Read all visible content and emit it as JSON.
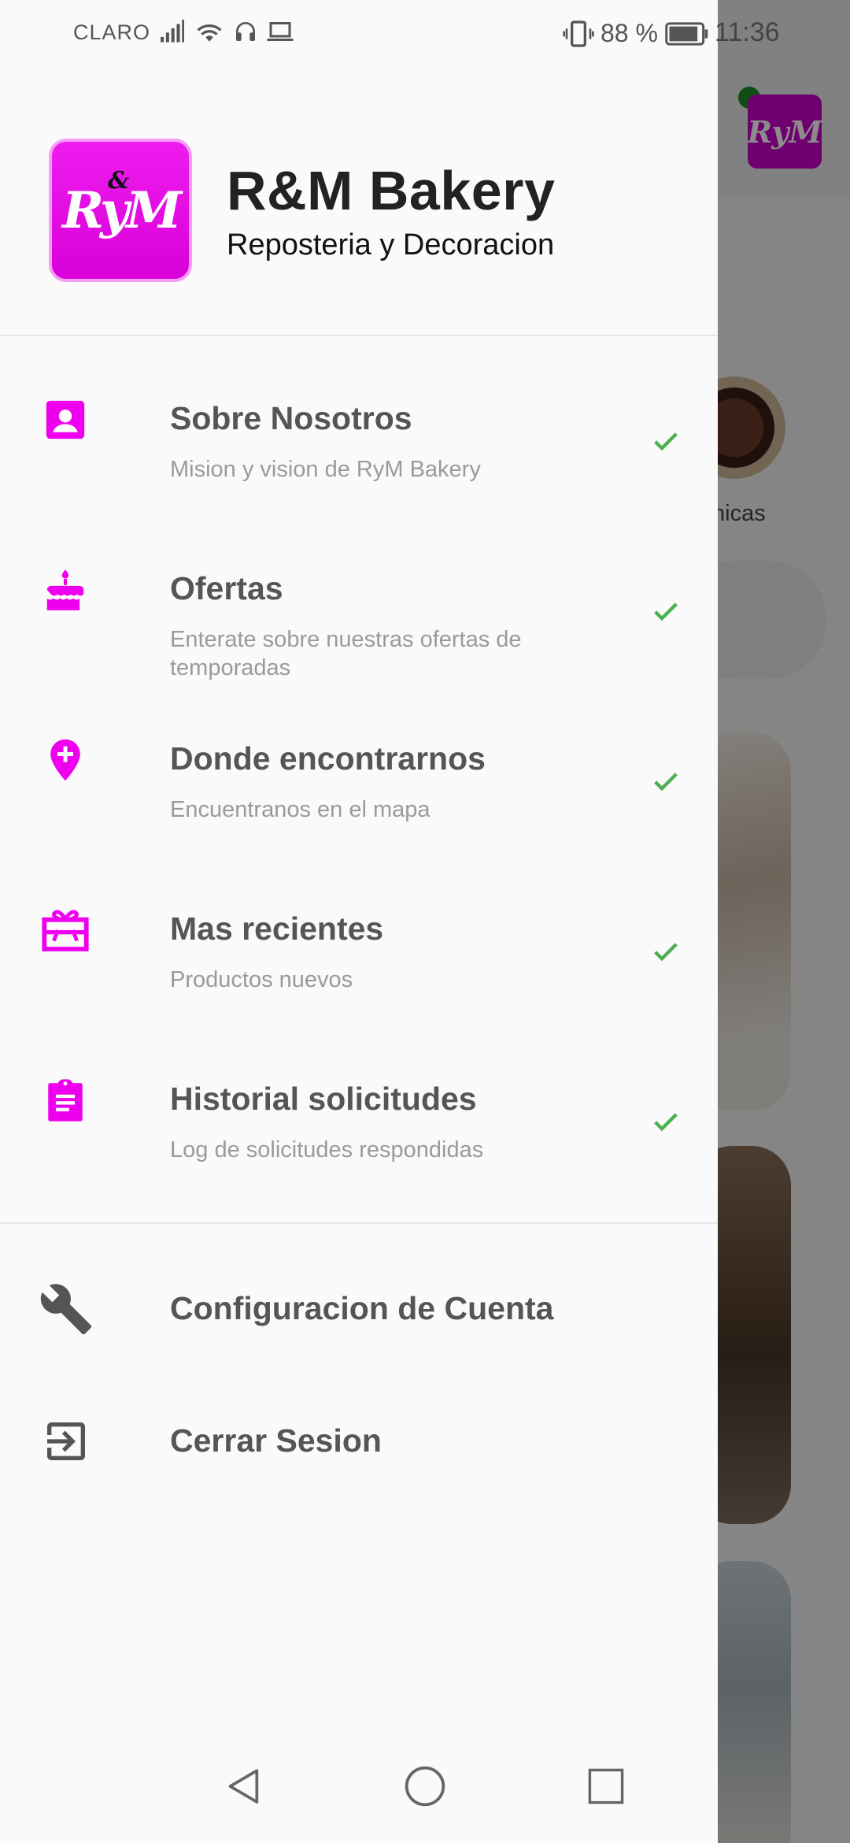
{
  "status_bar": {
    "carrier": "CLARO",
    "battery_percent": "88 %",
    "time": "11:36"
  },
  "colors": {
    "accent": "#ee00ee",
    "check": "#4caf50",
    "title_text": "#555555",
    "subtitle_text": "#9a9a9a"
  },
  "header": {
    "logo_text": "RyM",
    "logo_amp": "&",
    "title": "R&M Bakery",
    "subtitle": "Reposteria y Decoracion"
  },
  "menu": {
    "items": [
      {
        "title": "Sobre Nosotros",
        "subtitle": "Mision y vision de RyM Bakery",
        "icon": "person-card-icon",
        "checked": true
      },
      {
        "title": "Ofertas",
        "subtitle": "Enterate sobre nuestras ofertas de temporadas",
        "icon": "cake-icon",
        "checked": true
      },
      {
        "title": "Donde encontrarnos",
        "subtitle": "Encuentranos en el mapa",
        "icon": "map-pin-add-icon",
        "checked": true
      },
      {
        "title": "Mas recientes",
        "subtitle": "Productos nuevos",
        "icon": "gift-card-icon",
        "checked": true
      },
      {
        "title": "Historial solicitudes",
        "subtitle": "Log de solicitudes respondidas",
        "icon": "clipboard-icon",
        "checked": true
      }
    ]
  },
  "actions": {
    "account_settings": "Configuracion de Cuenta",
    "logout": "Cerrar Sesion"
  },
  "background": {
    "category_caption": "nicas"
  }
}
